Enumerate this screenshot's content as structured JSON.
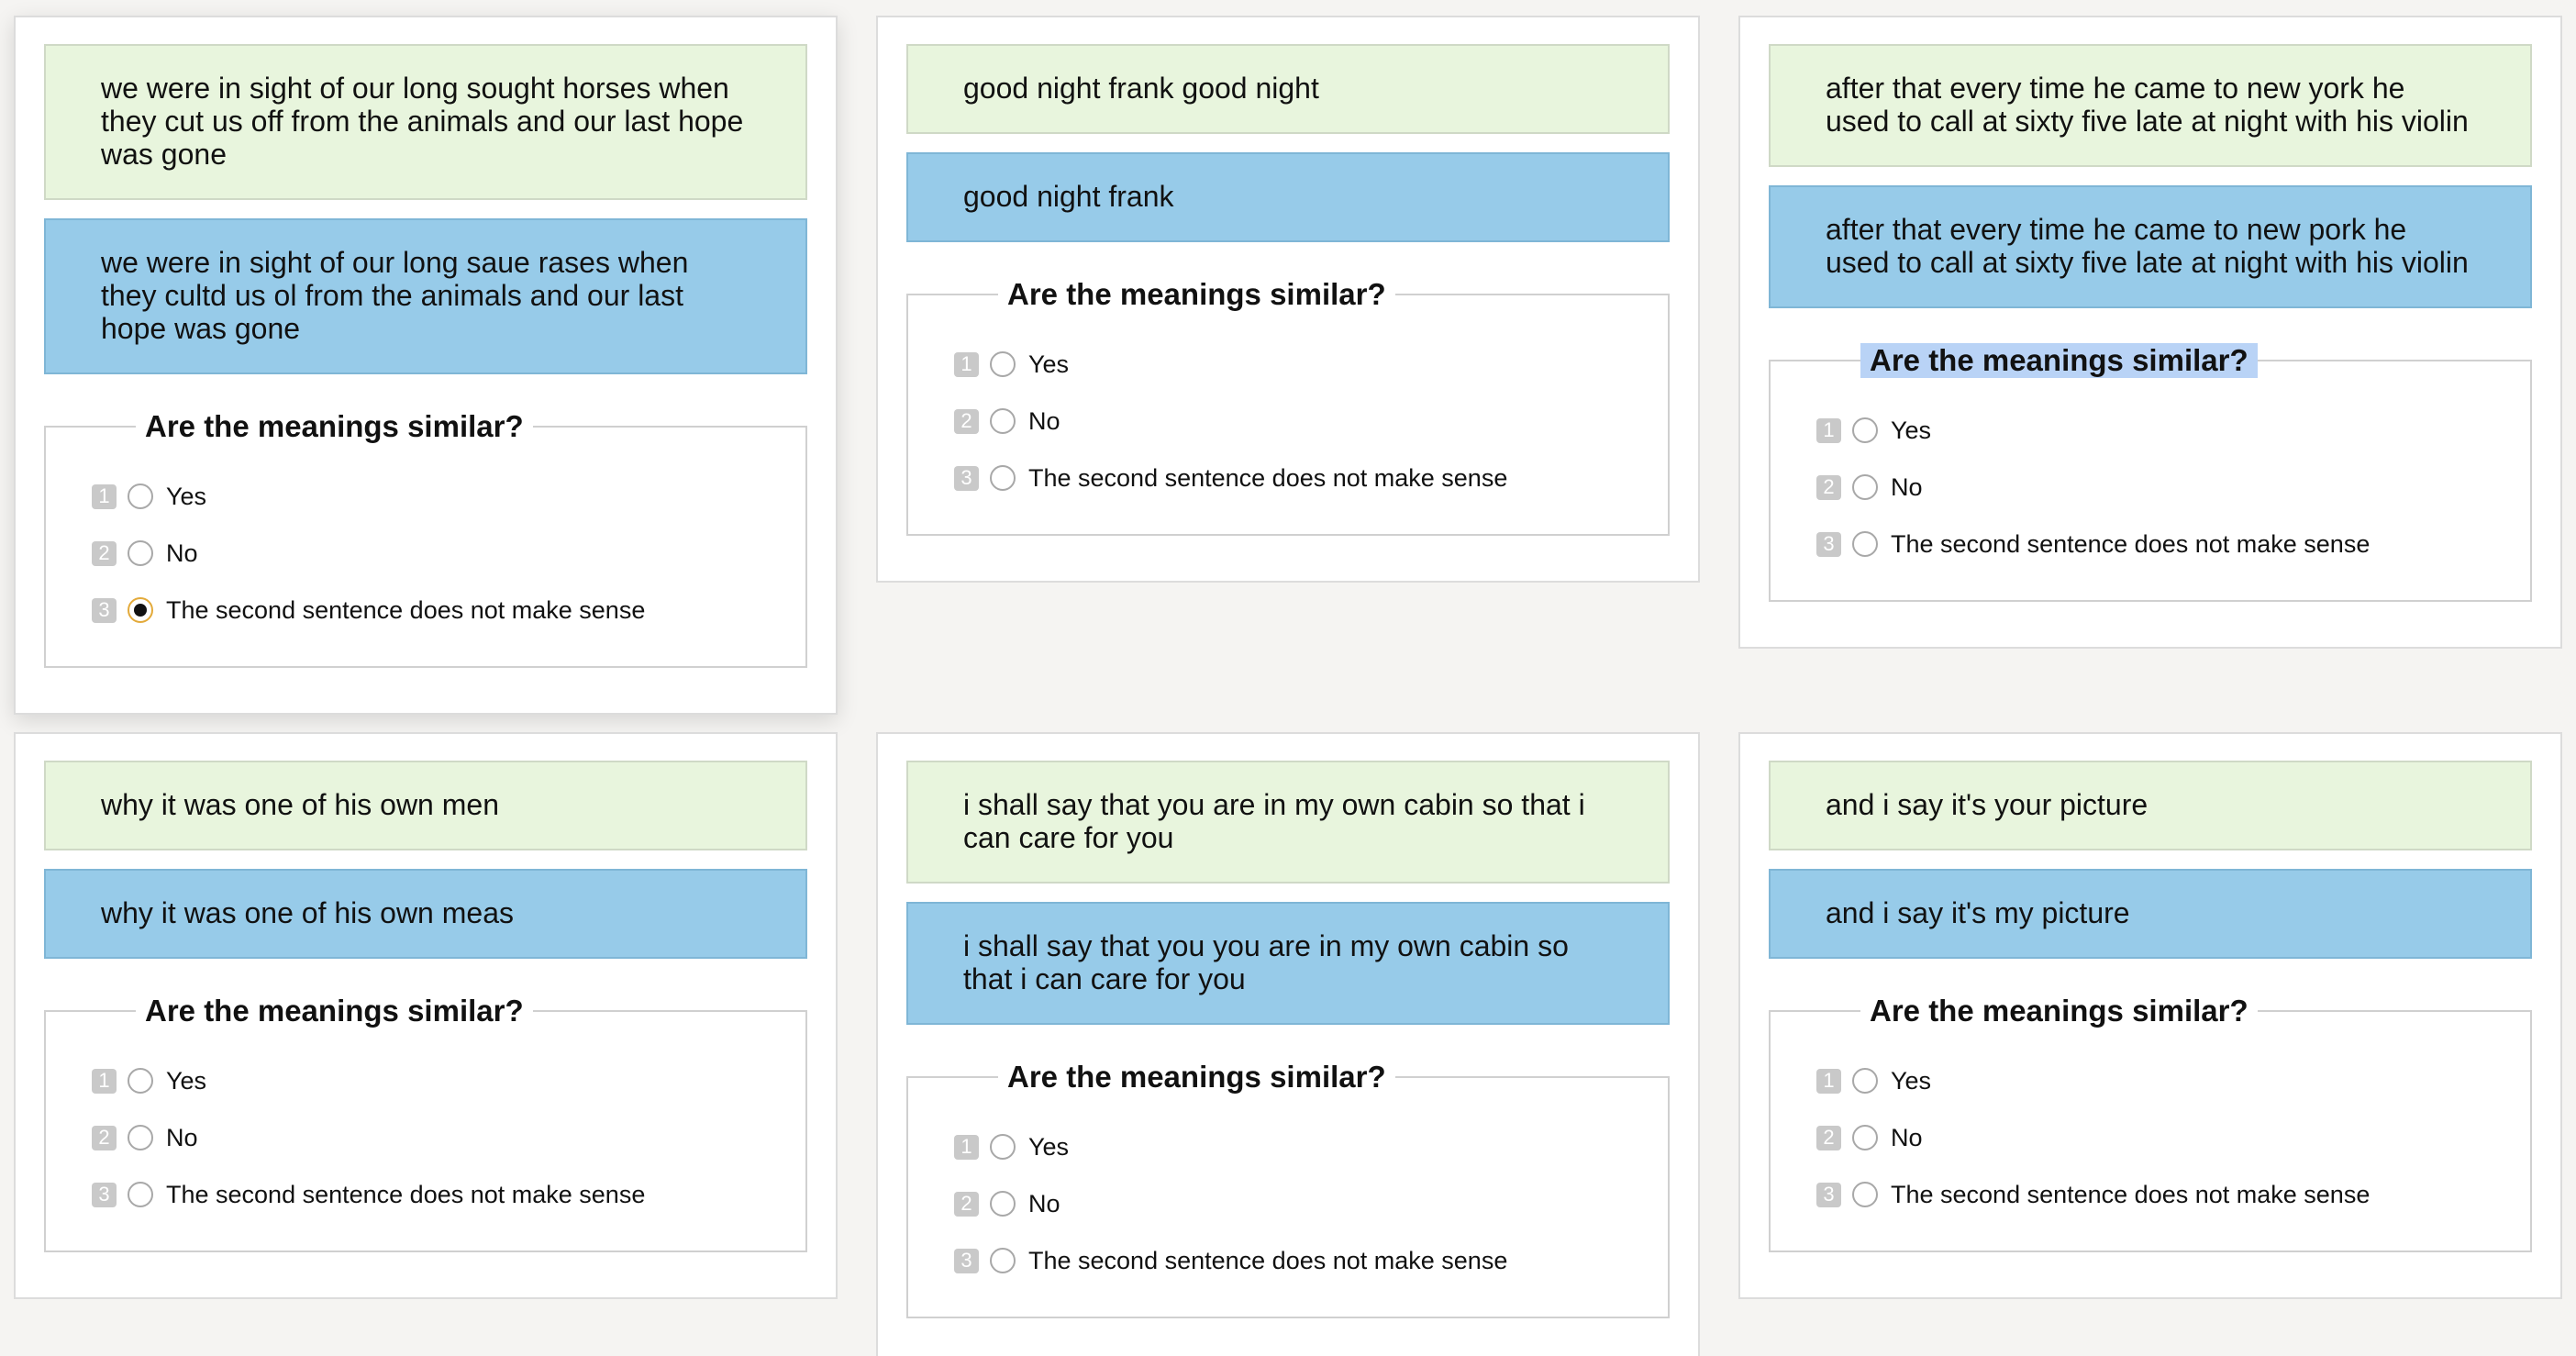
{
  "cards": [
    {
      "sentence_a": "we were in sight of our long sought horses when they cut us off from the animals and our last hope was gone",
      "sentence_b": "we were in sight of our long saue rases when they cultd us ol from the animals and our last hope was gone",
      "question": "Are the meanings similar?",
      "options": [
        {
          "key": "1",
          "label": "Yes"
        },
        {
          "key": "2",
          "label": "No"
        },
        {
          "key": "3",
          "label": "The second sentence does not make sense"
        }
      ],
      "selected_option": 3
    },
    {
      "sentence_a": "good night frank good night",
      "sentence_b": "good night frank",
      "question": "Are the meanings similar?",
      "options": [
        {
          "key": "1",
          "label": "Yes"
        },
        {
          "key": "2",
          "label": "No"
        },
        {
          "key": "3",
          "label": "The second sentence does not make sense"
        }
      ]
    },
    {
      "sentence_a": "after that every time he came to new york he used to call at sixty five late at night with his violin",
      "sentence_b": "after that every time he came to new pork he used to call at sixty five late at night with his violin",
      "question": "Are the meanings similar?",
      "options": [
        {
          "key": "1",
          "label": "Yes"
        },
        {
          "key": "2",
          "label": "No"
        },
        {
          "key": "3",
          "label": "The second sentence does not make sense"
        }
      ]
    },
    {
      "sentence_a": "why it was one of his own men",
      "sentence_b": "why it was one of his own meas",
      "question": "Are the meanings similar?",
      "options": [
        {
          "key": "1",
          "label": "Yes"
        },
        {
          "key": "2",
          "label": "No"
        },
        {
          "key": "3",
          "label": "The second sentence does not make sense"
        }
      ]
    },
    {
      "sentence_a": "i shall say that you are in my own cabin so that i can care for you",
      "sentence_b": "i shall say that you you are in my own cabin so that i can care for you",
      "question": "Are the meanings similar?",
      "options": [
        {
          "key": "1",
          "label": "Yes"
        },
        {
          "key": "2",
          "label": "No"
        },
        {
          "key": "3",
          "label": "The second sentence does not make sense"
        }
      ]
    },
    {
      "sentence_a": "and i say it's your picture",
      "sentence_b": "and i say it's my picture",
      "question": "Are the meanings similar?",
      "options": [
        {
          "key": "1",
          "label": "Yes"
        },
        {
          "key": "2",
          "label": "No"
        },
        {
          "key": "3",
          "label": "The second sentence does not make sense"
        }
      ]
    }
  ],
  "colors": {
    "page_background": "#f5f4f2",
    "sentence_a_background": "#e8f5dd",
    "sentence_b_background": "#97cbe9",
    "selected_radio_ring": "#e3aa3a",
    "legend_highlight": "#b9d3f6"
  }
}
